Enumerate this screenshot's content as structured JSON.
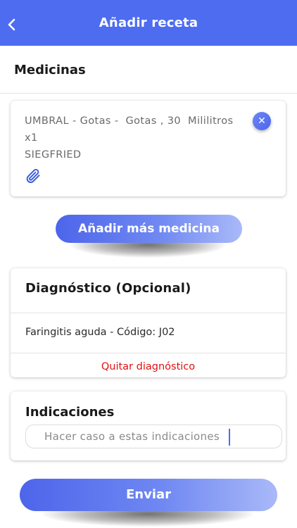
{
  "header": {
    "title": "Añadir receta",
    "back_icon": "chevron-left-icon"
  },
  "medicines": {
    "section_title": "Medicinas",
    "items": [
      {
        "line1": "UMBRAL - Gotas -  Gotas , 30  Mililitros",
        "line2": "x1",
        "line3": "SIEGFRIED",
        "remove_icon": "close-icon",
        "edit_icon": "paperclip-icon"
      }
    ],
    "add_more_label": "Añadir más medicina"
  },
  "diagnosis": {
    "title": "Diagnóstico (Opcional)",
    "value": "Faringitis aguda - Código: J02",
    "remove_label": "Quitar diagnóstico"
  },
  "indications": {
    "title": "Indicaciones",
    "placeholder": "Hacer caso a estas indicaciones"
  },
  "submit_label": "Enviar",
  "colors": {
    "header": "#4d6cf0",
    "accent": "#4d65ea",
    "danger": "#e01010"
  }
}
